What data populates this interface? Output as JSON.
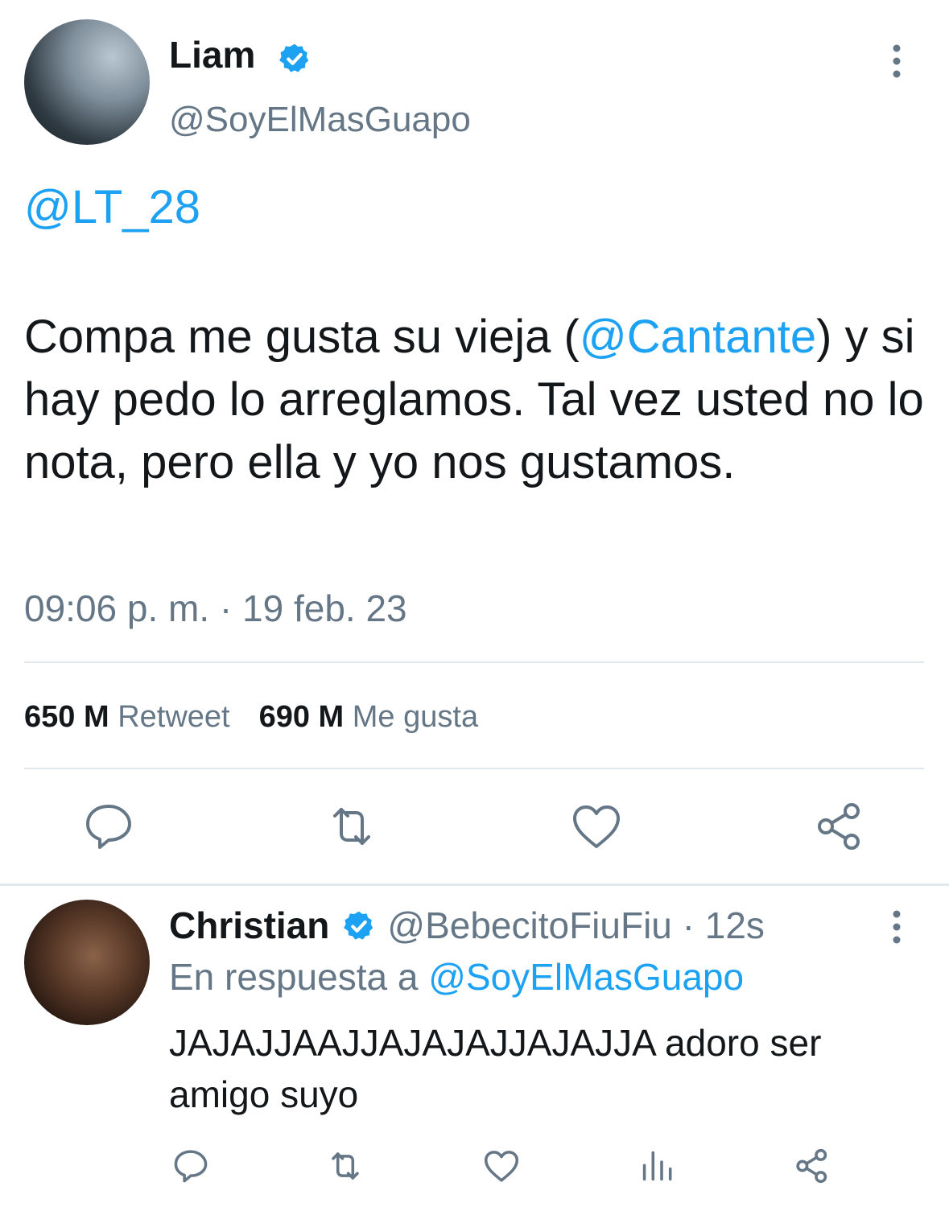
{
  "main_tweet": {
    "author_name": "Liam",
    "handle": "@SoyElMasGuapo",
    "mention": "@LT_28",
    "text_part1": "Compa me gusta su vieja (",
    "text_link": "@Cantante",
    "text_part2": ") y si hay pedo lo arreglamos. Tal vez usted no lo nota, pero ella y yo nos gustamos.",
    "timestamp": "09:06 p. m. · 19 feb. 23",
    "retweet_count": "650 M",
    "retweet_label": "Retweet",
    "like_count": "690 M",
    "like_label": "Me gusta"
  },
  "reply_tweet": {
    "author_name": "Christian",
    "handle_time": "@BebecitoFiuFiu · 12s",
    "reply_prefix": "En respuesta a ",
    "reply_to": "@SoyElMasGuapo",
    "text": "JAJAJJAAJJAJAJAJJAJAJJA adoro ser amigo suyo"
  },
  "icons": {
    "verified": "verified-badge-icon",
    "more": "more-vertical-icon",
    "reply": "comment-icon",
    "retweet": "retweet-icon",
    "like": "heart-icon",
    "share": "share-icon",
    "analytics": "analytics-icon"
  },
  "colors": {
    "accent": "#1da1f2",
    "secondary_text": "#657786",
    "primary_text": "#14171a",
    "divider": "#e1e8ed"
  }
}
